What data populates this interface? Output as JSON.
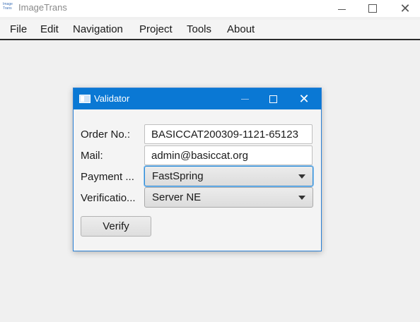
{
  "window": {
    "app_icon_text": "Image Trans",
    "title": "ImageTrans"
  },
  "menu": {
    "items": [
      "File",
      "Edit",
      "Navigation",
      "Project",
      "Tools",
      "About"
    ]
  },
  "dialog": {
    "title": "Validator",
    "order_label": "Order No.:",
    "order_value": "BASICCAT200309-1121-65123",
    "mail_label": "Mail:",
    "mail_value": "admin@basiccat.org",
    "payment_label": "Payment ...",
    "payment_value": "FastSpring",
    "verification_label": "Verificatio...",
    "verification_value": "Server NE",
    "verify_label": "Verify"
  },
  "icons": {
    "app": "imagetrans-app-icon",
    "minimize": "minimize-icon",
    "maximize": "maximize-icon",
    "close": "close-icon",
    "dropdown": "chevron-down-icon",
    "dialog_window": "window-icon"
  },
  "colors": {
    "dialog_titlebar": "#0a78d4",
    "focus_ring": "#2b8ad6",
    "background": "#f0f0f0"
  }
}
